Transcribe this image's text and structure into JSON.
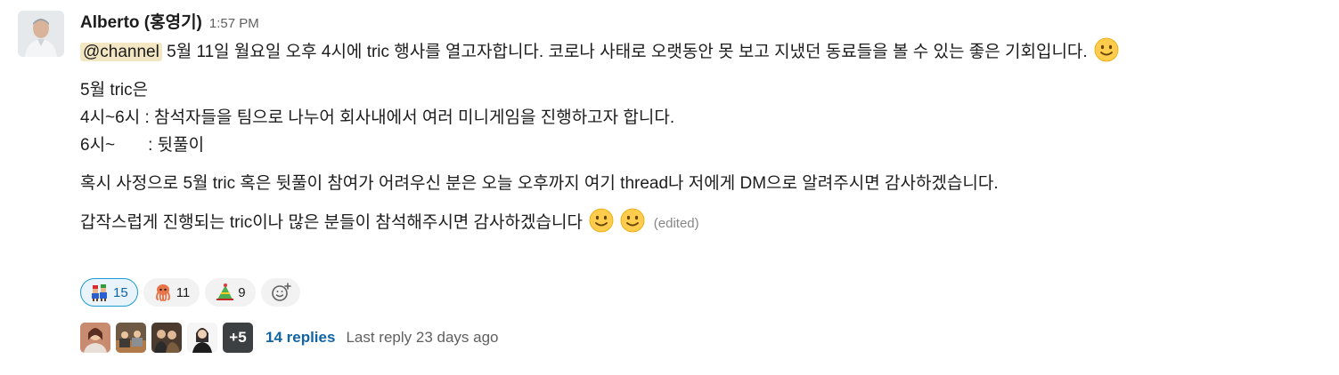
{
  "message": {
    "author": "Alberto (홍영기)",
    "time": "1:57 PM",
    "mention": "@channel",
    "line1": " 5월 11일 월요일 오후 4시에 tric 행사를 열고자합니다. 코로나 사태로 오랫동안 못 보고 지냈던 동료들을 볼 수 있는 좋은 기회입니다.",
    "schedule_title": "5월 tric은",
    "schedule_1": "4시~6시 : 참석자들을 팀으로 나누어 회사내에서 여러 미니게임을 진행하고자 합니다.",
    "schedule_2": "6시~       : 뒷풀이",
    "para2": "혹시 사정으로 5월 tric 혹은 뒷풀이 참여가 어려우신 분은 오늘 오후까지 여기 thread나 저에게 DM으로 알려주시면 감사하겠습니다.",
    "para3": "갑작스럽게 진행되는 tric이나 많은 분들이 참석해주시면 감사하겠습니다",
    "edited": "(edited)"
  },
  "reactions": [
    {
      "icon": "mario-luigi-emoji",
      "count": "15",
      "active": true
    },
    {
      "icon": "octopus-emoji",
      "count": "11",
      "active": false
    },
    {
      "icon": "party-hat-emoji",
      "count": "9",
      "active": false
    }
  ],
  "thread": {
    "more_count": "+5",
    "reply_count": "14 replies",
    "last_reply": "Last reply 23 days ago"
  },
  "colors": {
    "mention_bg": "#f2e6c3",
    "link": "#1264a3",
    "active_reaction_border": "#1d9bd1"
  }
}
